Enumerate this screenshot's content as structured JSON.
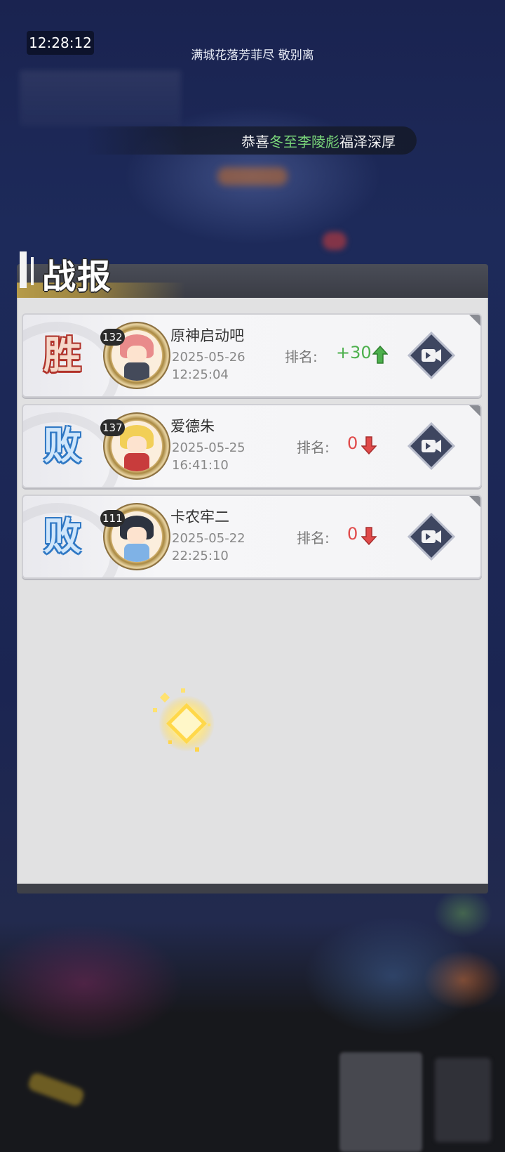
{
  "status_bar": {
    "time": "12:28:12"
  },
  "header": {
    "title": "满城花落芳菲尽 敬别离"
  },
  "marquee": {
    "prefix": "恭喜",
    "highlight": "冬至李陵彪",
    "suffix": "福泽深厚"
  },
  "panel": {
    "title": "战报"
  },
  "reports": [
    {
      "result": "胜",
      "outcome": "win",
      "level": "132",
      "name": "原神启动吧",
      "date": "2025-05-26",
      "time": "12:25:04",
      "rank_label": "排名:",
      "rank_change": "+30",
      "direction": "up",
      "avatar_hair": "#e98b8b",
      "avatar_body": "#444a5a"
    },
    {
      "result": "败",
      "outcome": "lose",
      "level": "137",
      "name": "爱德朱",
      "date": "2025-05-25",
      "time": "16:41:10",
      "rank_label": "排名:",
      "rank_change": "0",
      "direction": "down",
      "avatar_hair": "#f2cf57",
      "avatar_body": "#c83c3c"
    },
    {
      "result": "败",
      "outcome": "lose",
      "level": "111",
      "name": "卡农牢二",
      "date": "2025-05-22",
      "time": "22:25:10",
      "rank_label": "排名:",
      "rank_change": "0",
      "direction": "down",
      "avatar_hair": "#2d3340",
      "avatar_body": "#7fb2e6"
    }
  ],
  "colors": {
    "win": "#b2322a",
    "lose": "#2f78c4",
    "up": "#4db04d",
    "down": "#e04a4a"
  },
  "icons": {
    "video": "video-replay-icon",
    "up": "arrow-up-icon",
    "down": "arrow-down-icon"
  }
}
